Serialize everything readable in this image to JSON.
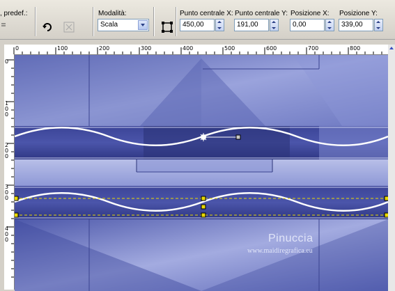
{
  "toolbar": {
    "preset_label": ", predef.:",
    "mode": {
      "label": "Modalità:",
      "value": "Scala"
    },
    "center_x": {
      "label": "Punto centrale X:",
      "value": "450,00"
    },
    "center_y": {
      "label": "Punto centrale Y:",
      "value": "191,00"
    },
    "pos_x": {
      "label": "Posizione X:",
      "value": "0,00"
    },
    "pos_y": {
      "label": "Posizione Y:",
      "value": "339,00"
    }
  },
  "ruler": {
    "top_ticks": [
      "0",
      "100",
      "200",
      "300",
      "400",
      "500",
      "600",
      "700",
      "800"
    ],
    "left_ticks": [
      "0",
      "1\n0\n0",
      "2\n0\n0",
      "3\n0\n0",
      "4\n0\n0"
    ]
  },
  "watermark": {
    "name": "Pinuccia",
    "url": "www.maidiregrafica.eu"
  },
  "colors": {
    "canvas_base": "#6f7bc4",
    "canvas_dark": "#2c3478",
    "wave": "#ffffff",
    "guide": "#e8d800"
  },
  "icons": [
    "rotate-icon",
    "reset-icon",
    "edit-mode-icon",
    "dropdown-arrow-icon",
    "spinner-icon",
    "center-point-icon"
  ]
}
